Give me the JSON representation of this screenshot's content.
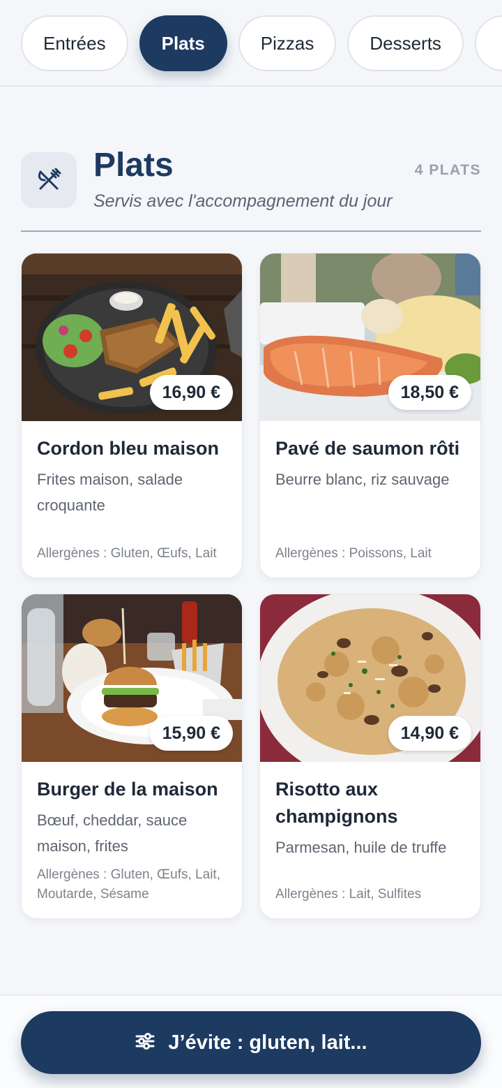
{
  "tabs": [
    {
      "label": "Entrées",
      "active": false
    },
    {
      "label": "Plats",
      "active": true
    },
    {
      "label": "Pizzas",
      "active": false
    },
    {
      "label": "Desserts",
      "active": false
    },
    {
      "label": "",
      "active": false
    }
  ],
  "section": {
    "icon": "utensils-crossed-icon",
    "title": "Plats",
    "subtitle": "Servis avec l'accompagnement du jour",
    "count": "4 PLATS"
  },
  "dishes": [
    {
      "name": "Cordon bleu maison",
      "description": "Frites maison, salade croquante",
      "allergens": "Allergènes : Gluten, Œufs, Lait",
      "price": "16,90 €"
    },
    {
      "name": "Pavé de saumon rôti",
      "description": "Beurre blanc, riz sauvage",
      "allergens": "Allergènes : Poissons, Lait",
      "price": "18,50 €"
    },
    {
      "name": "Burger de la maison",
      "description": "Bœuf, cheddar, sauce maison, frites",
      "allergens": "Allergènes : Gluten, Œufs, Lait, Moutarde, Sésame",
      "price": "15,90 €"
    },
    {
      "name": "Risotto aux champignons",
      "description": "Parmesan, huile de truffe",
      "allergens": "Allergènes : Lait, Sulfites",
      "price": "14,90 €"
    }
  ],
  "filter_button": {
    "icon": "sliders-icon",
    "label": "J’évite : gluten, lait..."
  },
  "colors": {
    "primary": "#1d3a61",
    "background": "#f4f6fa"
  }
}
